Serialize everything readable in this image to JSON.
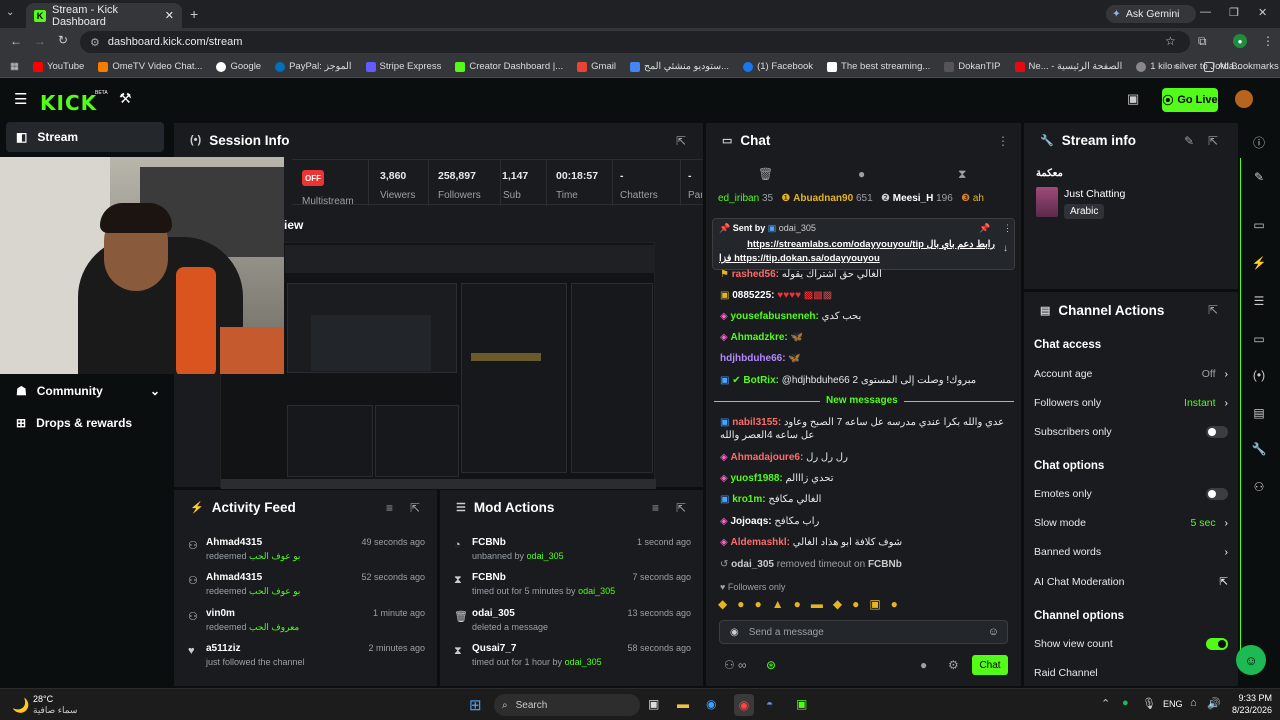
{
  "browser": {
    "tab_title": "Stream - Kick Dashboard",
    "url": "dashboard.kick.com/stream",
    "ask_gemini": "Ask Gemini",
    "bookmarks": [
      "YouTube",
      "OmeTV Video Chat...",
      "Google",
      "PayPal: الموجز",
      "Stripe Express",
      "Creator Dashboard |...",
      "Gmail",
      "ستوديو منشئي المح...",
      "(1) Facebook",
      "The best streaming...",
      "DokanTIP",
      "Ne... - الصفحة الرئيسية",
      "1 kilo silver to Jorda..."
    ],
    "all_bookmarks": "All Bookmarks"
  },
  "kick": {
    "logo": "KICK",
    "beta": "BETA",
    "go_live": "Go Live",
    "sidebar": {
      "stream": "Stream",
      "community": "Community",
      "drops": "Drops & rewards"
    }
  },
  "session": {
    "title": "Session Info",
    "status": "OFF",
    "status_label": "Multistream",
    "stats": [
      {
        "value": "3,860",
        "label": "Viewers"
      },
      {
        "value": "258,897",
        "label": "Followers"
      },
      {
        "value": "1,147",
        "label": "Sub"
      },
      {
        "value": "00:18:57",
        "label": "Time"
      },
      {
        "value": "-",
        "label": "Chatters"
      },
      {
        "value": "-",
        "label": "Parti"
      }
    ],
    "preview_label": "iew"
  },
  "activity": {
    "title": "Activity Feed",
    "items": [
      {
        "name": "Ahmad4315",
        "action": "redeemed",
        "detail": "بو عوف الحب",
        "time": "49 seconds ago"
      },
      {
        "name": "Ahmad4315",
        "action": "redeemed",
        "detail": "بو عوف الحب",
        "time": "52 seconds ago"
      },
      {
        "name": "vin0m",
        "action": "redeemed",
        "detail": "معروف الحب",
        "time": "1 minute ago"
      },
      {
        "name": "a511ziz",
        "action": "just followed the channel",
        "detail": "",
        "time": "2 minutes ago"
      }
    ]
  },
  "mod": {
    "title": "Mod Actions",
    "items": [
      {
        "name": "FCBNb",
        "action": "unbanned by",
        "by": "odai_305",
        "time": "1 second ago"
      },
      {
        "name": "FCBNb",
        "action": "timed out for 5 minutes by",
        "by": "odai_305",
        "time": "7 seconds ago"
      },
      {
        "name": "odai_305",
        "action": "deleted a message",
        "by": "",
        "time": "13 seconds ago"
      },
      {
        "name": "Qusai7_7",
        "action": "timed out for 1 hour by",
        "by": "odai_305",
        "time": "58 seconds ago"
      }
    ]
  },
  "chat": {
    "title": "Chat",
    "leaders": [
      {
        "name": "ed_iriban",
        "count": "35"
      },
      {
        "name": "Abuadnan90",
        "count": "651"
      },
      {
        "name": "Meesi_H",
        "count": "196"
      },
      {
        "name": "ah",
        "count": ""
      }
    ],
    "pinned_by_label": "Sent by",
    "pinned_by": "odai_305",
    "pinned_text_1": "رابط دعم باي بال https://streamlabs.com/odayyouyou/tip",
    "pinned_text_2": "فزا https://tip.dokan.sa/odayyouyou",
    "messages": [
      {
        "user": "rashed56:",
        "text": "الغالي حق اشتراك يقوله",
        "color": "#ff6b6b"
      },
      {
        "user": "0885225:",
        "text": "",
        "color": "#ffffff"
      },
      {
        "user": "yousefabusneneh:",
        "text": "بحب كدي",
        "color": "#53fc18"
      },
      {
        "user": "Ahmadzkre:",
        "text": "",
        "color": "#53fc18"
      },
      {
        "user": "hdjhbduhe66:",
        "text": "",
        "color": "#b388ff"
      },
      {
        "user": "BotRix:",
        "text": "@hdjhbduhe66 مبروك! وصلت إلى المستوى 2",
        "color": "#53fc18"
      }
    ],
    "new_messages": "New messages",
    "messages2": [
      {
        "user": "nabil3155:",
        "text": "عدي والله بكرا عندي مدرسه عل ساعه 7 الصبح وعاود عل ساعه 4العصر والله",
        "color": "#ff6b6b"
      },
      {
        "user": "Ahmadajoure6:",
        "text": "رل رل رل",
        "color": "#ff6b6b"
      },
      {
        "user": "yuosf1988:",
        "text": "تحدي زااالم",
        "color": "#53fc18"
      },
      {
        "user": "kro1m:",
        "text": "الغالي مكافح",
        "color": "#53fc18"
      },
      {
        "user": "Jojoaqs:",
        "text": "راب مكافح",
        "color": "#ffffff"
      },
      {
        "user": "Aldemashkl:",
        "text": "شوف كلافة ابو هذاد الغالي",
        "color": "#ff6b6b"
      }
    ],
    "mod_notice_user": "odai_305",
    "mod_notice_text": "removed timeout on",
    "mod_notice_target": "FCBNb",
    "followers_only": "Followers only",
    "input_placeholder": "Send a message",
    "send": "Chat"
  },
  "stream_info": {
    "title": "Stream info",
    "stream_title": "معكمة",
    "category": "Just Chatting",
    "language": "Arabic"
  },
  "channel_actions": {
    "title": "Channel Actions",
    "chat_access": "Chat access",
    "account_age": "Account age",
    "account_age_val": "Off",
    "followers_only": "Followers only",
    "followers_only_val": "Instant",
    "subscribers_only": "Subscribers only",
    "chat_options": "Chat options",
    "emotes_only": "Emotes only",
    "slow_mode": "Slow mode",
    "slow_mode_val": "5 sec",
    "banned_words": "Banned words",
    "ai_mod": "AI Chat Moderation",
    "channel_options": "Channel options",
    "show_view_count": "Show view count",
    "raid_channel": "Raid Channel"
  },
  "taskbar": {
    "temp": "28°C",
    "weather": "سماء صافية",
    "search": "Search",
    "lang": "ENG",
    "time": "9:33 PM",
    "date": "8/23/2026"
  },
  "colors": {
    "accent": "#53fc18",
    "panel": "#191b1f",
    "bg": "#0b0e0f"
  }
}
